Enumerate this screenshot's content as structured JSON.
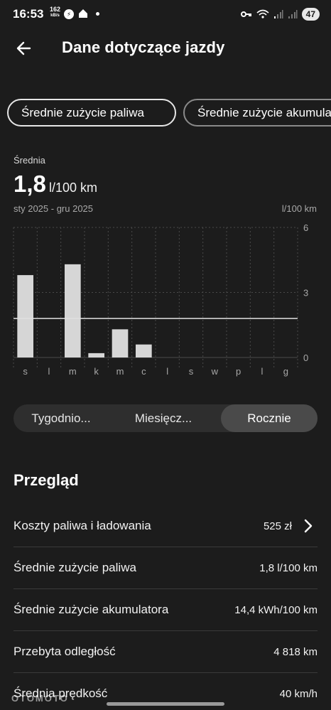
{
  "status_bar": {
    "time": "16:53",
    "net_speed_value": "162",
    "net_speed_unit": "kB/s",
    "battery": "47",
    "icons": [
      "messenger-icon",
      "home-app-icon",
      "key-icon",
      "wifi-icon",
      "signal-icon",
      "signal-icon"
    ]
  },
  "header": {
    "title": "Dane dotyczące jazdy"
  },
  "tabs": [
    {
      "label": "Średnie zużycie paliwa",
      "active": true
    },
    {
      "label": "Średnie zużycie akumulatora",
      "active": false
    }
  ],
  "summary": {
    "label": "Średnia",
    "value": "1,8",
    "unit": "l/100 km",
    "date_range": "sty 2025 - gru 2025",
    "chart_unit": "l/100 km"
  },
  "chart_data": {
    "type": "bar",
    "categories": [
      "s",
      "l",
      "m",
      "k",
      "m",
      "c",
      "l",
      "s",
      "w",
      "p",
      "l",
      "g"
    ],
    "values": [
      3.8,
      0,
      4.3,
      0.2,
      1.3,
      0.6,
      0,
      0,
      0,
      0,
      0,
      0
    ],
    "y_ticks": [
      "6",
      "3",
      "0"
    ],
    "ylim": [
      0,
      6
    ],
    "average_line": 1.8,
    "grid": true,
    "colors": {
      "bar": "#d6d6d6",
      "grid": "#4a4a4a",
      "average": "#e0e0e0"
    }
  },
  "period_selector": {
    "options": [
      {
        "label": "Tygodnio...",
        "active": false
      },
      {
        "label": "Miesięcz...",
        "active": false
      },
      {
        "label": "Rocznie",
        "active": true
      }
    ]
  },
  "overview": {
    "title": "Przegląd",
    "rows": [
      {
        "label": "Koszty paliwa i ładowania",
        "value": "525 zł"
      },
      {
        "label": "Średnie zużycie paliwa",
        "value": "1,8 l/100 km"
      },
      {
        "label": "Średnie zużycie akumulatora",
        "value": "14,4 kWh/100 km"
      },
      {
        "label": "Przebyta odległość",
        "value": "4 818 km"
      },
      {
        "label": "Średnia prędkość",
        "value": "40 km/h"
      }
    ]
  },
  "watermark": "OTOMOTO"
}
